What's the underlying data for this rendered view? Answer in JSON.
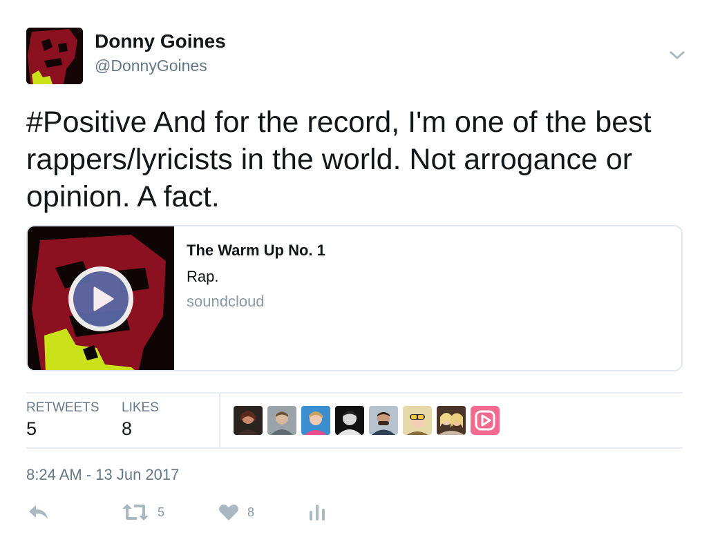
{
  "author": {
    "name": "Donny Goines",
    "handle": "@DonnyGoines"
  },
  "tweet": {
    "text": "#Positive And for the record, I'm one of the best rappers/lyricists in the world. Not arrogance or opinion. A fact.",
    "timestamp": "8:24 AM - 13 Jun 2017"
  },
  "card": {
    "title": "The Warm Up No. 1",
    "description": "Rap.",
    "domain": "soundcloud"
  },
  "stats": {
    "retweets_label": "RETWEETS",
    "retweets_value": "5",
    "likes_label": "LIKES",
    "likes_value": "8"
  },
  "actions": {
    "retweet_count": "5",
    "like_count": "8"
  },
  "colors": {
    "text": "#14171a",
    "secondary": "#657786",
    "border": "#e1e8ed",
    "play_button": "#5a6ba8",
    "action_icon": "#aab8c2"
  }
}
